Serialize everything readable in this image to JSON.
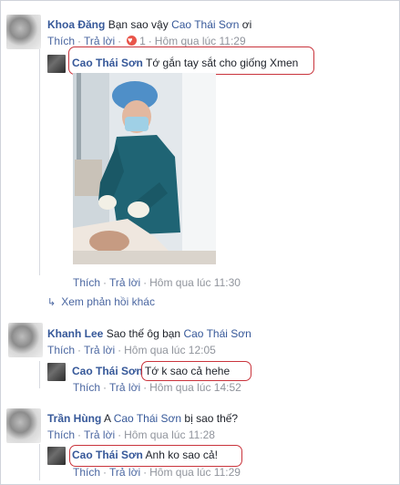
{
  "comments": [
    {
      "author": "Khoa Đăng",
      "text_prefix": "Bạn sao vậy ",
      "tagged": "Cao Thái Sơn",
      "text_suffix": " ơi",
      "like_label": "Thích",
      "reply_label": "Trả lời",
      "reaction_count": "1",
      "timestamp": "Hôm qua lúc 11:29",
      "reply": {
        "author": "Cao Thái Sơn",
        "text": "Tớ gắn tay sắt cho giống Xmen",
        "like_label": "Thích",
        "reply_label": "Trả lời",
        "timestamp": "Hôm qua lúc 11:30"
      },
      "more_replies_label": "Xem phản hồi khác"
    },
    {
      "author": "Khanh Lee",
      "text_prefix": "Sao thế ôg bạn ",
      "tagged": "Cao Thái Sơn",
      "text_suffix": "",
      "like_label": "Thích",
      "reply_label": "Trả lời",
      "timestamp": "Hôm qua lúc 12:05",
      "reply": {
        "author": "Cao Thái Sơn",
        "text": "Tớ k sao cả hehe",
        "like_label": "Thích",
        "reply_label": "Trả lời",
        "timestamp": "Hôm qua lúc 14:52"
      }
    },
    {
      "author": "Trần Hùng",
      "text_prefix": "A ",
      "tagged": "Cao Thái Sơn",
      "text_suffix": " bị sao thế?",
      "like_label": "Thích",
      "reply_label": "Trả lời",
      "timestamp": "Hôm qua lúc 11:28",
      "reply": {
        "author": "Cao Thái Sơn",
        "text": "Anh ko sao cả!",
        "like_label": "Thích",
        "reply_label": "Trả lời",
        "timestamp": "Hôm qua lúc 11:29"
      }
    }
  ],
  "colors": {
    "link": "#365899",
    "meta": "#90949c",
    "highlight": "#c9343c",
    "reaction": "#e9554a"
  }
}
